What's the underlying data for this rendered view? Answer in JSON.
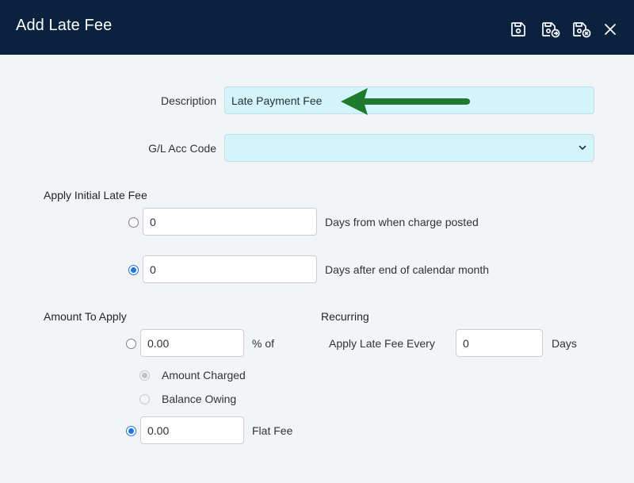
{
  "header": {
    "title": "Add Late Fee",
    "icons": [
      "save-icon",
      "save-and-new-icon",
      "save-and-close-icon",
      "close-icon"
    ],
    "background": "#0b223f"
  },
  "form": {
    "description": {
      "label": "Description",
      "value": "Late Payment Fee"
    },
    "gl_code": {
      "label": "G/L Acc Code",
      "value": ""
    },
    "required_field_color": "#d2f4fa"
  },
  "initial_fee": {
    "heading": "Apply Initial Late Fee",
    "option1": {
      "value": "0",
      "text": "Days from when charge posted",
      "selected": false
    },
    "option2": {
      "value": "0",
      "text": "Days after end of calendar month",
      "selected": true
    }
  },
  "amount": {
    "heading": "Amount To Apply",
    "percent": {
      "value": "0.00",
      "text": "% of",
      "selected": false
    },
    "amount_charged": "Amount Charged",
    "balance_owing": "Balance Owing",
    "flat": {
      "value": "0.00",
      "text": "Flat Fee",
      "selected": true
    }
  },
  "recurring": {
    "heading": "Recurring",
    "label": "Apply Late Fee Every",
    "value": "0",
    "unit": "Days"
  },
  "annotation": {
    "color": "#1f7a2e",
    "icon": "green-arrow-pointer"
  },
  "accent": "#1a73e8"
}
